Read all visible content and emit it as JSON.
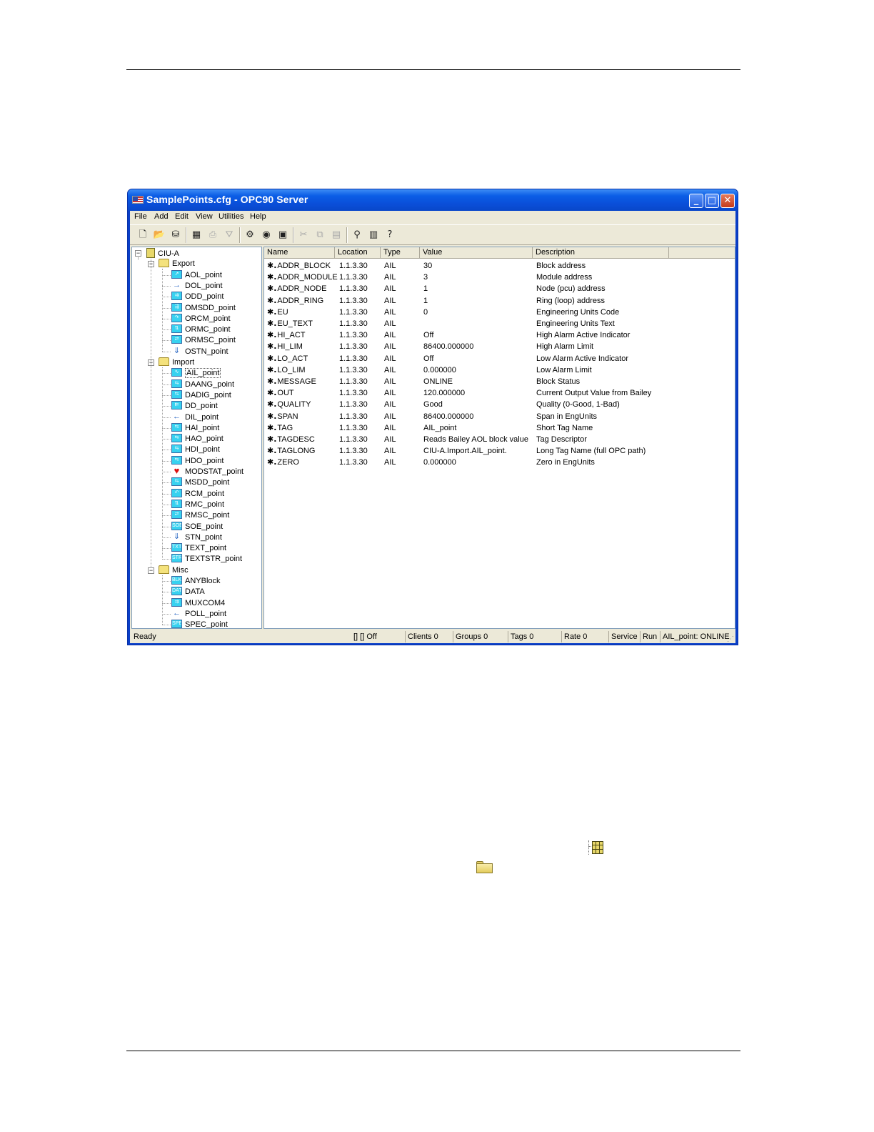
{
  "window": {
    "title": "SamplePoints.cfg - OPC90 Server",
    "controls": {
      "minimize": "_",
      "maximize": "□",
      "close": "✕"
    }
  },
  "menu": [
    "File",
    "Add",
    "Edit",
    "View",
    "Utilities",
    "Help"
  ],
  "toolbar": {
    "groups": [
      [
        "new-icon",
        "open-icon",
        "database-icon"
      ],
      [
        "grid-icon",
        "print-icon",
        "preview-icon"
      ],
      [
        "network-icon",
        "connect-icon",
        "save-icon"
      ],
      [
        "cut-icon",
        "copy-icon",
        "paste-icon"
      ],
      [
        "about-icon",
        "help-book-icon",
        "context-help-icon"
      ]
    ],
    "disabled": [
      "print-icon",
      "preview-icon",
      "cut-icon",
      "copy-icon",
      "paste-icon"
    ]
  },
  "tree": {
    "root": "CIU-A",
    "folders": [
      {
        "label": "Export",
        "items": [
          "AOL_point",
          "DOL_point",
          "ODD_point",
          "OMSDD_point",
          "ORCM_point",
          "ORMC_point",
          "ORMSC_point",
          "OSTN_point"
        ]
      },
      {
        "label": "Import",
        "items": [
          "AIL_point",
          "DAANG_point",
          "DADIG_point",
          "DD_point",
          "DIL_point",
          "HAI_point",
          "HAO_point",
          "HDI_point",
          "HDO_point",
          "MODSTAT_point",
          "MSDD_point",
          "RCM_point",
          "RMC_point",
          "RMSC_point",
          "SOE_point",
          "STN_point",
          "TEXT_point",
          "TEXTSTR_point"
        ]
      },
      {
        "label": "Misc",
        "items": [
          "ANYBlock",
          "DATA",
          "MUXCOM4",
          "POLL_point",
          "SPEC_point"
        ]
      }
    ],
    "selected": "AIL_point"
  },
  "list": {
    "columns": [
      "Name",
      "Location",
      "Type",
      "Value",
      "Description"
    ],
    "rows": [
      [
        "ADDR_BLOCK",
        "1.1.3.30",
        "AIL",
        "30",
        "Block address"
      ],
      [
        "ADDR_MODULE",
        "1.1.3.30",
        "AIL",
        "3",
        "Module address"
      ],
      [
        "ADDR_NODE",
        "1.1.3.30",
        "AIL",
        "1",
        "Node (pcu) address"
      ],
      [
        "ADDR_RING",
        "1.1.3.30",
        "AIL",
        "1",
        "Ring (loop) address"
      ],
      [
        "EU",
        "1.1.3.30",
        "AIL",
        "0",
        "Engineering Units Code"
      ],
      [
        "EU_TEXT",
        "1.1.3.30",
        "AIL",
        "",
        "Engineering Units Text"
      ],
      [
        "HI_ACT",
        "1.1.3.30",
        "AIL",
        "Off",
        "High Alarm Active Indicator"
      ],
      [
        "HI_LIM",
        "1.1.3.30",
        "AIL",
        "86400.000000",
        "High Alarm Limit"
      ],
      [
        "LO_ACT",
        "1.1.3.30",
        "AIL",
        "Off",
        "Low Alarm Active Indicator"
      ],
      [
        "LO_LIM",
        "1.1.3.30",
        "AIL",
        "0.000000",
        "Low Alarm Limit"
      ],
      [
        "MESSAGE",
        "1.1.3.30",
        "AIL",
        "ONLINE",
        "Block Status"
      ],
      [
        "OUT",
        "1.1.3.30",
        "AIL",
        "120.000000",
        "Current Output Value from Bailey"
      ],
      [
        "QUALITY",
        "1.1.3.30",
        "AIL",
        "Good",
        "Quality (0-Good, 1-Bad)"
      ],
      [
        "SPAN",
        "1.1.3.30",
        "AIL",
        "86400.000000",
        "Span in EngUnits"
      ],
      [
        "TAG",
        "1.1.3.30",
        "AIL",
        "AIL_point",
        "Short Tag Name"
      ],
      [
        "TAGDESC",
        "1.1.3.30",
        "AIL",
        "Reads Bailey AOL block value",
        "Tag Descriptor"
      ],
      [
        "TAGLONG",
        "1.1.3.30",
        "AIL",
        "CIU-A.Import.AIL_point.",
        "Long Tag Name (full OPC path)"
      ],
      [
        "ZERO",
        "1.1.3.30",
        "AIL",
        "0.000000",
        "Zero in EngUnits"
      ]
    ]
  },
  "status": {
    "ready": "Ready",
    "indicator": "[]  [] Off",
    "clients": "Clients 0",
    "groups": "Groups 0",
    "tags": "Tags 0",
    "rate": "Rate 0",
    "service": "Service",
    "run": "Run",
    "point": "AIL_point: ONLINE"
  },
  "legend_icons": [
    "config-root-icon",
    "folder-icon"
  ]
}
